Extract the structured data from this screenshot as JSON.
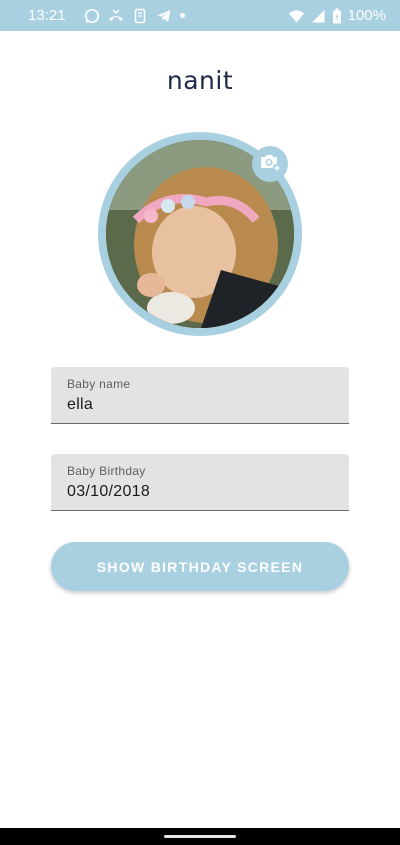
{
  "status_bar": {
    "time": "13:21",
    "battery": "100%",
    "left_icons": [
      "whatsapp-icon",
      "missed-call-icon",
      "storage-icon",
      "telegram-icon",
      "dot"
    ],
    "right_icons": [
      "wifi-icon",
      "signal-icon",
      "battery-icon"
    ]
  },
  "app": {
    "logo": "nanit"
  },
  "avatar": {
    "add_photo_icon": "add-photo-camera-icon"
  },
  "form": {
    "name_label": "Baby name",
    "name_value": "ella",
    "birthday_label": "Baby Birthday",
    "birthday_value": "03/10/2018"
  },
  "cta": {
    "label": "SHOW BIRTHDAY SCREEN"
  },
  "colors": {
    "accent": "#a9d0e0",
    "logo": "#1e2a4a",
    "field_bg": "#e3e3e3"
  }
}
